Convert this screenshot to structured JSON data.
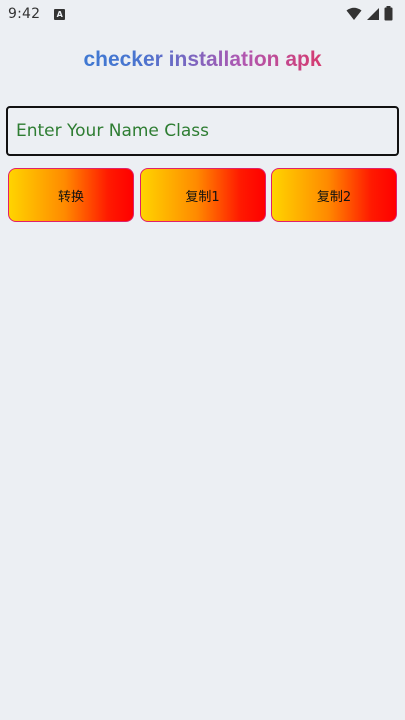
{
  "status_bar": {
    "time": "9:42",
    "notification_icon": "a-icon",
    "right_icons": [
      "wifi-icon",
      "signal-icon",
      "battery-icon"
    ]
  },
  "app": {
    "title": "checker installation apk"
  },
  "input": {
    "placeholder": "Enter Your Name Class",
    "value": ""
  },
  "buttons": [
    {
      "label": "转换"
    },
    {
      "label": "复制1"
    },
    {
      "label": "复制2"
    }
  ],
  "colors": {
    "background": "#eceff3",
    "title_gradient_start": "#2f7fd6",
    "title_gradient_end": "#c6307a",
    "placeholder": "#2e7d32",
    "button_gradient_start": "#ffd400",
    "button_gradient_end": "#ff0000",
    "button_border": "#e0206a"
  }
}
